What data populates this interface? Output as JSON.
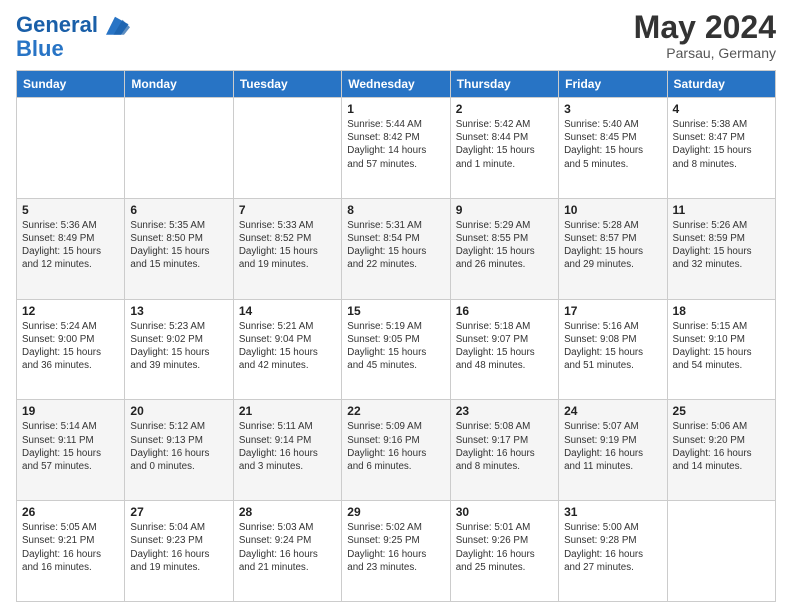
{
  "header": {
    "logo_line1": "General",
    "logo_line2": "Blue",
    "title": "May 2024",
    "location": "Parsau, Germany"
  },
  "days": [
    "Sunday",
    "Monday",
    "Tuesday",
    "Wednesday",
    "Thursday",
    "Friday",
    "Saturday"
  ],
  "weeks": [
    [
      {
        "date": "",
        "sunrise": "",
        "sunset": "",
        "daylight": ""
      },
      {
        "date": "",
        "sunrise": "",
        "sunset": "",
        "daylight": ""
      },
      {
        "date": "",
        "sunrise": "",
        "sunset": "",
        "daylight": ""
      },
      {
        "date": "1",
        "sunrise": "Sunrise: 5:44 AM",
        "sunset": "Sunset: 8:42 PM",
        "daylight": "Daylight: 14 hours and 57 minutes."
      },
      {
        "date": "2",
        "sunrise": "Sunrise: 5:42 AM",
        "sunset": "Sunset: 8:44 PM",
        "daylight": "Daylight: 15 hours and 1 minute."
      },
      {
        "date": "3",
        "sunrise": "Sunrise: 5:40 AM",
        "sunset": "Sunset: 8:45 PM",
        "daylight": "Daylight: 15 hours and 5 minutes."
      },
      {
        "date": "4",
        "sunrise": "Sunrise: 5:38 AM",
        "sunset": "Sunset: 8:47 PM",
        "daylight": "Daylight: 15 hours and 8 minutes."
      }
    ],
    [
      {
        "date": "5",
        "sunrise": "Sunrise: 5:36 AM",
        "sunset": "Sunset: 8:49 PM",
        "daylight": "Daylight: 15 hours and 12 minutes."
      },
      {
        "date": "6",
        "sunrise": "Sunrise: 5:35 AM",
        "sunset": "Sunset: 8:50 PM",
        "daylight": "Daylight: 15 hours and 15 minutes."
      },
      {
        "date": "7",
        "sunrise": "Sunrise: 5:33 AM",
        "sunset": "Sunset: 8:52 PM",
        "daylight": "Daylight: 15 hours and 19 minutes."
      },
      {
        "date": "8",
        "sunrise": "Sunrise: 5:31 AM",
        "sunset": "Sunset: 8:54 PM",
        "daylight": "Daylight: 15 hours and 22 minutes."
      },
      {
        "date": "9",
        "sunrise": "Sunrise: 5:29 AM",
        "sunset": "Sunset: 8:55 PM",
        "daylight": "Daylight: 15 hours and 26 minutes."
      },
      {
        "date": "10",
        "sunrise": "Sunrise: 5:28 AM",
        "sunset": "Sunset: 8:57 PM",
        "daylight": "Daylight: 15 hours and 29 minutes."
      },
      {
        "date": "11",
        "sunrise": "Sunrise: 5:26 AM",
        "sunset": "Sunset: 8:59 PM",
        "daylight": "Daylight: 15 hours and 32 minutes."
      }
    ],
    [
      {
        "date": "12",
        "sunrise": "Sunrise: 5:24 AM",
        "sunset": "Sunset: 9:00 PM",
        "daylight": "Daylight: 15 hours and 36 minutes."
      },
      {
        "date": "13",
        "sunrise": "Sunrise: 5:23 AM",
        "sunset": "Sunset: 9:02 PM",
        "daylight": "Daylight: 15 hours and 39 minutes."
      },
      {
        "date": "14",
        "sunrise": "Sunrise: 5:21 AM",
        "sunset": "Sunset: 9:04 PM",
        "daylight": "Daylight: 15 hours and 42 minutes."
      },
      {
        "date": "15",
        "sunrise": "Sunrise: 5:19 AM",
        "sunset": "Sunset: 9:05 PM",
        "daylight": "Daylight: 15 hours and 45 minutes."
      },
      {
        "date": "16",
        "sunrise": "Sunrise: 5:18 AM",
        "sunset": "Sunset: 9:07 PM",
        "daylight": "Daylight: 15 hours and 48 minutes."
      },
      {
        "date": "17",
        "sunrise": "Sunrise: 5:16 AM",
        "sunset": "Sunset: 9:08 PM",
        "daylight": "Daylight: 15 hours and 51 minutes."
      },
      {
        "date": "18",
        "sunrise": "Sunrise: 5:15 AM",
        "sunset": "Sunset: 9:10 PM",
        "daylight": "Daylight: 15 hours and 54 minutes."
      }
    ],
    [
      {
        "date": "19",
        "sunrise": "Sunrise: 5:14 AM",
        "sunset": "Sunset: 9:11 PM",
        "daylight": "Daylight: 15 hours and 57 minutes."
      },
      {
        "date": "20",
        "sunrise": "Sunrise: 5:12 AM",
        "sunset": "Sunset: 9:13 PM",
        "daylight": "Daylight: 16 hours and 0 minutes."
      },
      {
        "date": "21",
        "sunrise": "Sunrise: 5:11 AM",
        "sunset": "Sunset: 9:14 PM",
        "daylight": "Daylight: 16 hours and 3 minutes."
      },
      {
        "date": "22",
        "sunrise": "Sunrise: 5:09 AM",
        "sunset": "Sunset: 9:16 PM",
        "daylight": "Daylight: 16 hours and 6 minutes."
      },
      {
        "date": "23",
        "sunrise": "Sunrise: 5:08 AM",
        "sunset": "Sunset: 9:17 PM",
        "daylight": "Daylight: 16 hours and 8 minutes."
      },
      {
        "date": "24",
        "sunrise": "Sunrise: 5:07 AM",
        "sunset": "Sunset: 9:19 PM",
        "daylight": "Daylight: 16 hours and 11 minutes."
      },
      {
        "date": "25",
        "sunrise": "Sunrise: 5:06 AM",
        "sunset": "Sunset: 9:20 PM",
        "daylight": "Daylight: 16 hours and 14 minutes."
      }
    ],
    [
      {
        "date": "26",
        "sunrise": "Sunrise: 5:05 AM",
        "sunset": "Sunset: 9:21 PM",
        "daylight": "Daylight: 16 hours and 16 minutes."
      },
      {
        "date": "27",
        "sunrise": "Sunrise: 5:04 AM",
        "sunset": "Sunset: 9:23 PM",
        "daylight": "Daylight: 16 hours and 19 minutes."
      },
      {
        "date": "28",
        "sunrise": "Sunrise: 5:03 AM",
        "sunset": "Sunset: 9:24 PM",
        "daylight": "Daylight: 16 hours and 21 minutes."
      },
      {
        "date": "29",
        "sunrise": "Sunrise: 5:02 AM",
        "sunset": "Sunset: 9:25 PM",
        "daylight": "Daylight: 16 hours and 23 minutes."
      },
      {
        "date": "30",
        "sunrise": "Sunrise: 5:01 AM",
        "sunset": "Sunset: 9:26 PM",
        "daylight": "Daylight: 16 hours and 25 minutes."
      },
      {
        "date": "31",
        "sunrise": "Sunrise: 5:00 AM",
        "sunset": "Sunset: 9:28 PM",
        "daylight": "Daylight: 16 hours and 27 minutes."
      },
      {
        "date": "",
        "sunrise": "",
        "sunset": "",
        "daylight": ""
      }
    ]
  ]
}
